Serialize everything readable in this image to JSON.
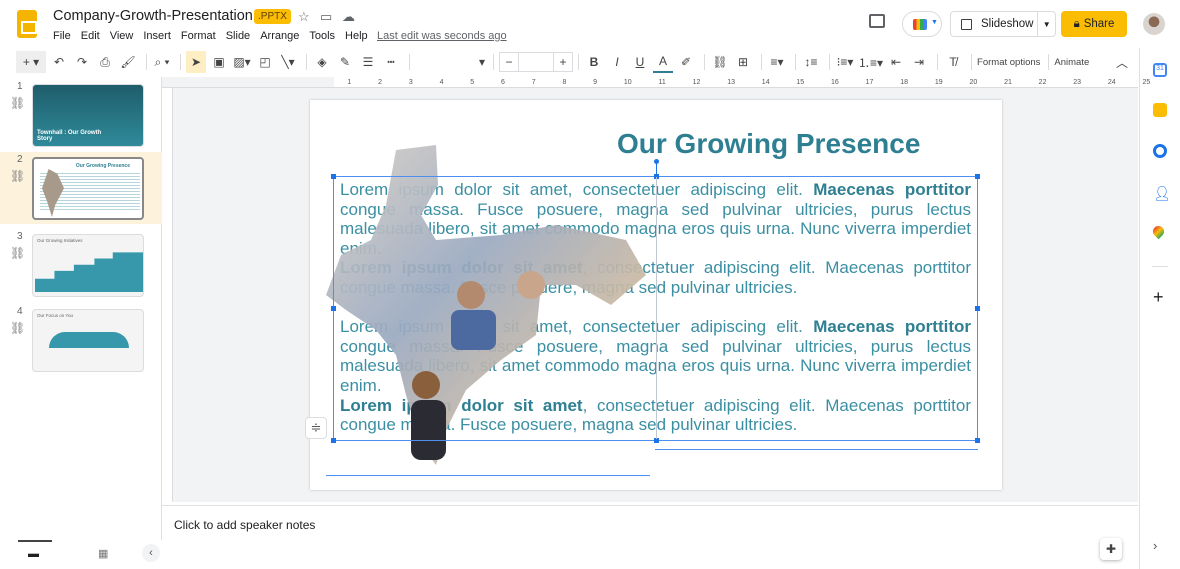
{
  "header": {
    "doc_title": "Company-Growth-Presentation",
    "file_badge": ".PPTX",
    "menu": [
      "File",
      "Edit",
      "View",
      "Insert",
      "Format",
      "Slide",
      "Arrange",
      "Tools",
      "Help"
    ],
    "last_edit": "Last edit was seconds ago",
    "slideshow_label": "Slideshow",
    "share_label": "Share"
  },
  "toolbar": {
    "format_options": "Format options",
    "animate": "Animate",
    "font_size": ""
  },
  "ruler": {
    "ticks": [
      "1",
      "2",
      "3",
      "4",
      "5",
      "6",
      "7",
      "8",
      "9",
      "10",
      "11",
      "12",
      "13",
      "14",
      "15",
      "16",
      "17",
      "18",
      "19",
      "20",
      "21",
      "22",
      "23",
      "24",
      "25"
    ]
  },
  "filmstrip": {
    "slides": [
      {
        "number": "1",
        "title": "Townhall : Our Growth Story"
      },
      {
        "number": "2",
        "title": "Our Growing Presence"
      },
      {
        "number": "3",
        "title": "Our Growing Initiatives"
      },
      {
        "number": "4",
        "title": "Our Focus on You"
      }
    ],
    "selected": 2
  },
  "slide": {
    "title": "Our Growing Presence",
    "paragraphs": [
      {
        "bold_lead": "",
        "text": "Lorem ipsum dolor sit amet, consectetuer adipiscing elit. ",
        "bold_tail": "Maecenas porttitor",
        "rest": " congue massa. Fusce posuere, magna sed pulvinar ultricies, purus lectus malesuada libero, sit amet commodo magna eros quis urna. Nunc viverra imperdiet enim."
      },
      {
        "bold_lead": "Lorem ipsum dolor sit amet",
        "text": ", consectetuer adipiscing elit. Maecenas porttitor congue massa. Fusce posuere, magna sed pulvinar ultricies.",
        "bold_tail": "",
        "rest": ""
      },
      {
        "bold_lead": "",
        "text": "Lorem ipsum dolor sit amet, consectetuer adipiscing elit. ",
        "bold_tail": "Maecenas porttitor",
        "rest": " congue massa. Fusce posuere, magna sed pulvinar ultricies, purus lectus malesuada libero, sit amet commodo magna eros quis urna. Nunc viverra imperdiet enim."
      },
      {
        "bold_lead": "Lorem ipsum dolor sit amet",
        "text": ", consectetuer adipiscing elit. Maecenas porttitor congue massa. Fusce posuere, magna sed pulvinar ultricies.",
        "bold_tail": "",
        "rest": ""
      }
    ]
  },
  "notes": {
    "placeholder": "Click to add speaker notes"
  },
  "colors": {
    "accent": "#fbbc04",
    "slide_text": "#3b8fa3",
    "slide_title": "#2e7f92",
    "selection": "#1a73e8"
  }
}
